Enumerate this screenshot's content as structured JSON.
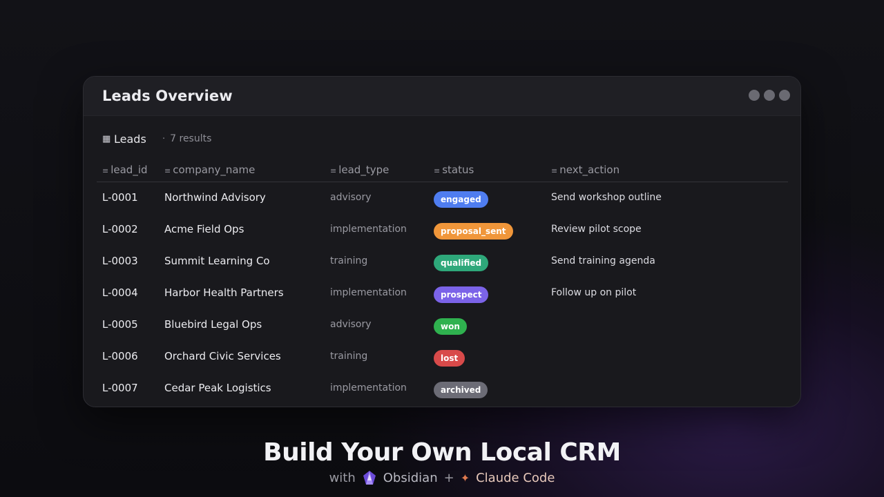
{
  "window": {
    "title": "Leads Overview"
  },
  "base": {
    "icon": "table-icon",
    "name": "Leads",
    "separator": "·",
    "results": "7 results"
  },
  "columns": [
    {
      "label": "lead_id",
      "icon": "text-icon"
    },
    {
      "label": "company_name",
      "icon": "text-icon"
    },
    {
      "label": "lead_type",
      "icon": "text-icon"
    },
    {
      "label": "status",
      "icon": "text-icon"
    },
    {
      "label": "next_action",
      "icon": "text-icon"
    }
  ],
  "rows": [
    {
      "lead_id": "L-0001",
      "company_name": "Northwind Advisory",
      "lead_type": "advisory",
      "status": "engaged",
      "status_color": "#4f7df0",
      "next_action": "Send workshop outline"
    },
    {
      "lead_id": "L-0002",
      "company_name": "Acme Field Ops",
      "lead_type": "implementation",
      "status": "proposal_sent",
      "status_color": "#f0963a",
      "next_action": "Review pilot scope"
    },
    {
      "lead_id": "L-0003",
      "company_name": "Summit Learning Co",
      "lead_type": "training",
      "status": "qualified",
      "status_color": "#2ea87a",
      "next_action": "Send training agenda"
    },
    {
      "lead_id": "L-0004",
      "company_name": "Harbor Health Partners",
      "lead_type": "implementation",
      "status": "prospect",
      "status_color": "#7b63e8",
      "next_action": "Follow up on pilot"
    },
    {
      "lead_id": "L-0005",
      "company_name": "Bluebird Legal Ops",
      "lead_type": "advisory",
      "status": "won",
      "status_color": "#2fb14f",
      "next_action": ""
    },
    {
      "lead_id": "L-0006",
      "company_name": "Orchard Civic Services",
      "lead_type": "training",
      "status": "lost",
      "status_color": "#d84a4a",
      "next_action": ""
    },
    {
      "lead_id": "L-0007",
      "company_name": "Cedar Peak Logistics",
      "lead_type": "implementation",
      "status": "archived",
      "status_color": "#6c6c76",
      "next_action": ""
    }
  ],
  "footer": {
    "headline": "Build Your Own Local CRM",
    "with": "with",
    "obsidian": "Obsidian",
    "plus": "+",
    "claude": "Claude Code"
  }
}
